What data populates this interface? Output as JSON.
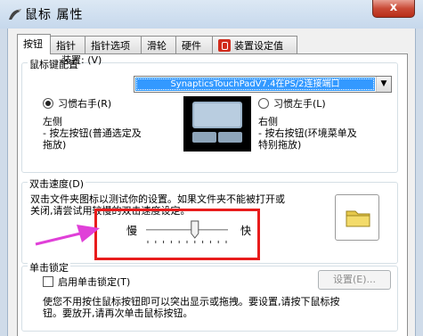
{
  "window": {
    "title": "鼠标 属性",
    "close_label": "x"
  },
  "tabs": [
    {
      "label": "按钮",
      "active": true
    },
    {
      "label": "指针"
    },
    {
      "label": "指针选项"
    },
    {
      "label": "滑轮"
    },
    {
      "label": "硬件"
    },
    {
      "label": "装置设定值",
      "icon": "device-settings-icon"
    }
  ],
  "mouse_keys": {
    "group_title": "鼠标键配置",
    "device_label": "装置:",
    "device_hotkey": "(V)",
    "device_value": "SynapticsTouchPadV7.4在PS/2连接端口",
    "right_hand_label": "习惯右手(R)",
    "left_hand_label": "习惯左手(L)",
    "right_hand_checked": true,
    "left_side_heading": "左侧",
    "left_side_desc_line1": "- 按左按钮(普通选定及",
    "left_side_desc_line2": "拖放)",
    "right_side_heading": "右侧",
    "right_side_desc_line1": "- 按右按钮(环境菜单及",
    "right_side_desc_line2": "特别拖放)"
  },
  "double_click": {
    "group_title": "双击速度(D)",
    "desc_line1": "双击文件夹图标以测试你的设置。如果文件夹不能被打开或",
    "desc_line2": "关闭,请尝试用较慢的双击速度设定。",
    "slow_label": "慢",
    "fast_label": "快",
    "slider_fraction": 0.6,
    "tick_count": 11
  },
  "click_lock": {
    "group_title": "单击锁定",
    "checkbox_label": "启用单击锁定(T)",
    "checked": false,
    "settings_button": "设置(E)...",
    "desc_line1": "使您不用按住鼠标按钮即可以突出显示或拖拽。要设置,请按下鼠标按",
    "desc_line2": "钮。要放开,请再次单击鼠标按钮。"
  },
  "colors": {
    "highlight": "#e81c1c",
    "annotation_arrow": "#e040d8",
    "selection": "#3399ff"
  }
}
